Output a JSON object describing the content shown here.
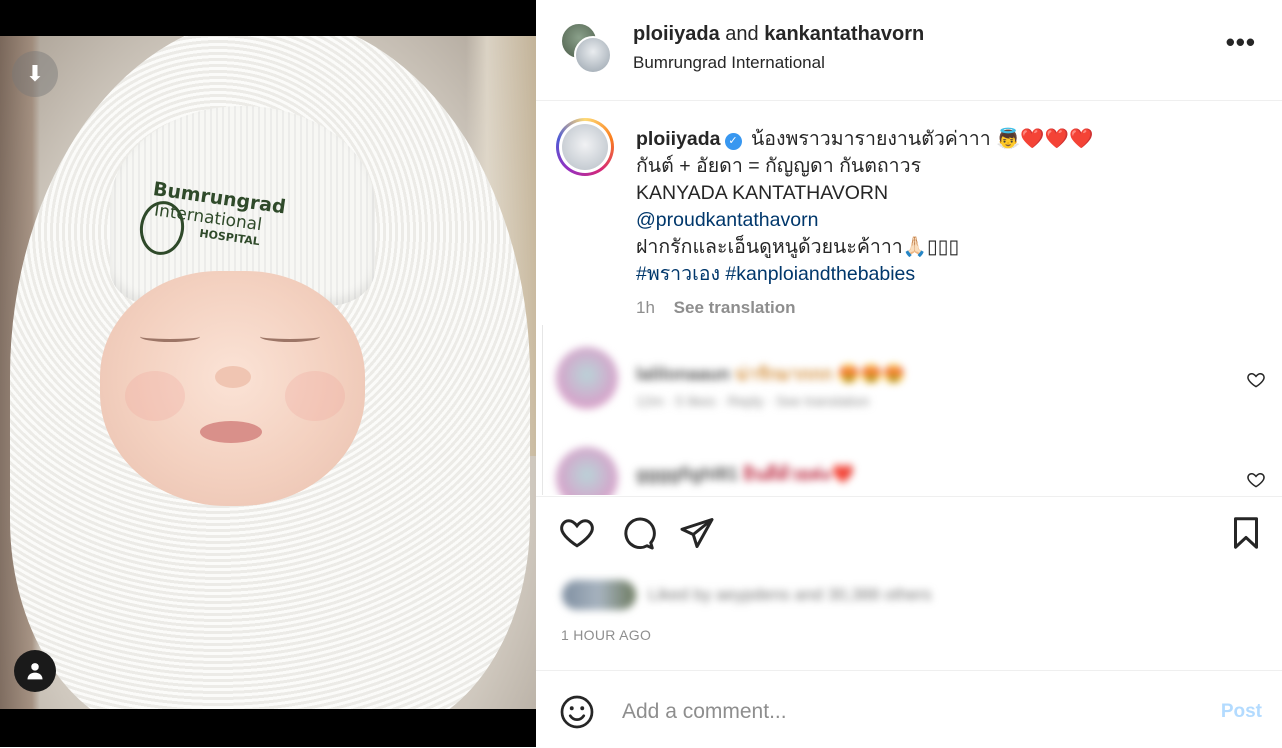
{
  "media": {
    "hat_line1": "Bumrungrad",
    "hat_line2": "International",
    "hat_line3": "HOSPITAL"
  },
  "header": {
    "user1": "ploiiyada",
    "and_text": "and",
    "user2": "kankantathavorn",
    "location": "Bumrungrad International",
    "more": "•••"
  },
  "caption": {
    "username": "ploiiyada",
    "line1": " น้องพราวมารายงานตัวค่าาา 👼❤️❤️❤️",
    "line2": "กันต์ + อัยดา = กัญญดา กันตถาวร",
    "line3": "KANYADA KANTATHAVORN",
    "mention": "@proudkantathavorn",
    "line5": "ฝากรักและเอ็นดูหนูด้วยนะค้าาา🙏🏻▯▯▯",
    "hashtag1": "#พราวเอง",
    "hashtag2": "#kanploiandthebabies",
    "time_ago": "1h",
    "see_translation": "See translation"
  },
  "comments": [
    {
      "username": "lalilonaaun",
      "text": "น่ารักมากกก 😍😍😍",
      "meta": "12m · 5 likes · Reply · See translation"
    },
    {
      "username": "ggggfighl81",
      "text": "ยินดีด้วยค่ะ❤️",
      "meta": ""
    }
  ],
  "likes": {
    "text": "Liked by aeypdens and 30,388 others"
  },
  "timestamp": "1 HOUR AGO",
  "add_comment": {
    "placeholder": "Add a comment...",
    "post_label": "Post"
  },
  "colors": {
    "link": "#00376b",
    "verified": "#3897f0",
    "post_disabled": "#b3dbff",
    "like_heart": "#ed4956"
  }
}
